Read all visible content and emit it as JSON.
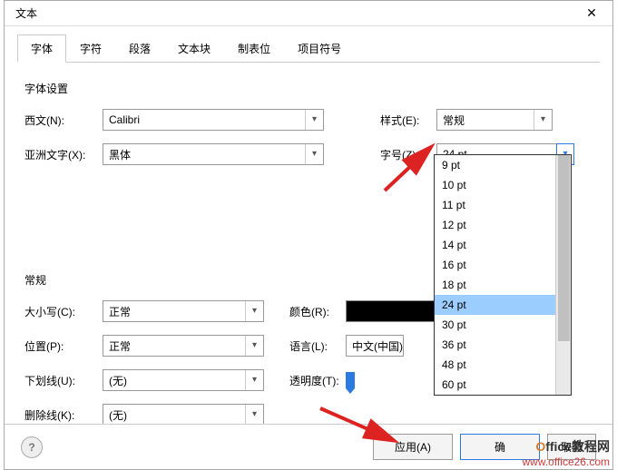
{
  "dialog_title": "文本",
  "tabs": [
    "字体",
    "字符",
    "段落",
    "文本块",
    "制表位",
    "项目符号"
  ],
  "active_tab_index": 0,
  "section_font": "字体设置",
  "section_general": "常规",
  "labels": {
    "latin": "西文(N):",
    "asian": "亚洲文字(X):",
    "style": "样式(E):",
    "size": "字号(Z):",
    "case": "大小写(C):",
    "color": "颜色(R):",
    "position": "位置(P):",
    "language": "语言(L):",
    "underline": "下划线(U):",
    "transparency": "透明度(T):",
    "strike": "删除线(K):"
  },
  "values": {
    "latin": "Calibri",
    "asian": "黑体",
    "style": "常规",
    "size": "24 pt",
    "case": "正常",
    "position": "正常",
    "language": "中文(中国)",
    "underline": "(无)",
    "strike": "(无)",
    "color": "#000000",
    "transparency": "0%"
  },
  "size_options": [
    "9 pt",
    "10 pt",
    "11 pt",
    "12 pt",
    "14 pt",
    "16 pt",
    "18 pt",
    "24 pt",
    "30 pt",
    "36 pt",
    "48 pt",
    "60 pt"
  ],
  "buttons": {
    "apply": "应用(A)",
    "ok_partial": "确",
    "cancel_partial": "取消"
  },
  "watermark": {
    "brand": "Office教程网",
    "url": "www.office26.com"
  }
}
